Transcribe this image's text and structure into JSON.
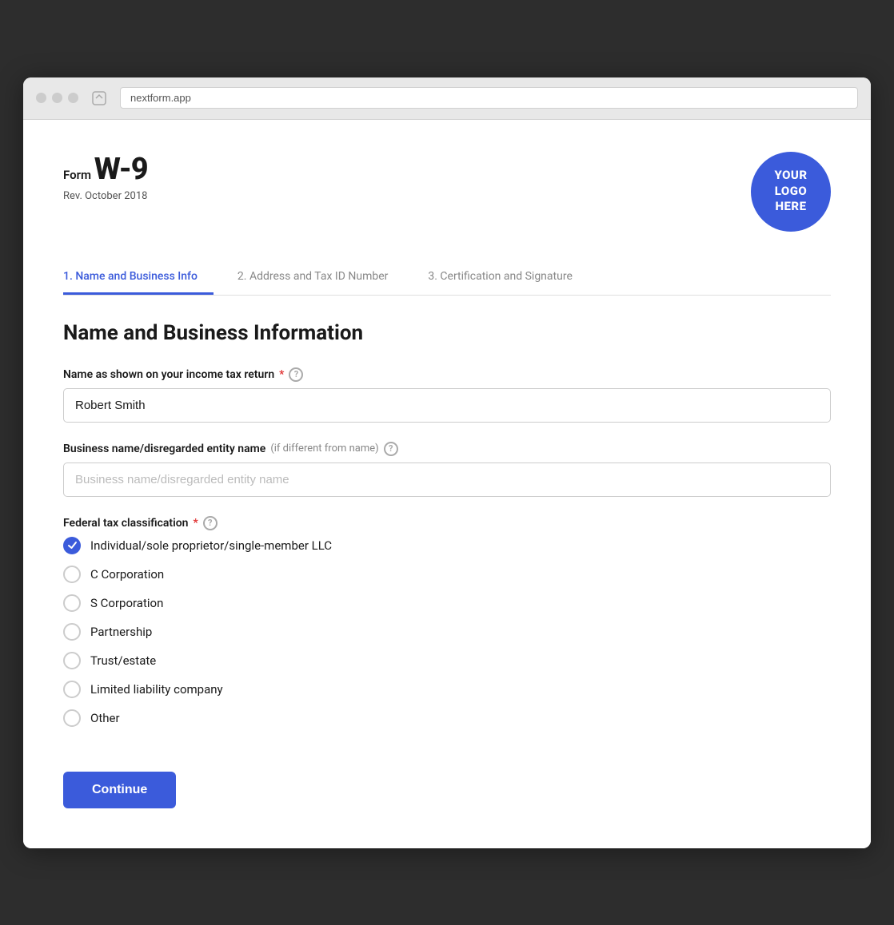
{
  "browser": {
    "address": "nextform.app",
    "nav_icon": "◇"
  },
  "logo": {
    "line1": "YOUR",
    "line2": "LOGO",
    "line3": "HERE"
  },
  "form": {
    "prefix": "Form",
    "title": "W-9",
    "subtitle": "Rev. October 2018"
  },
  "tabs": [
    {
      "id": "tab1",
      "label": "1. Name and Business Info",
      "active": true
    },
    {
      "id": "tab2",
      "label": "2. Address and Tax ID Number",
      "active": false
    },
    {
      "id": "tab3",
      "label": "3. Certification and Signature",
      "active": false
    }
  ],
  "section": {
    "title": "Name and Business Information"
  },
  "fields": {
    "name_label": "Name as shown on your income tax return",
    "name_value": "Robert Smith",
    "name_placeholder": "",
    "business_label": "Business name/disregarded entity name",
    "business_optional": "(if different from name)",
    "business_placeholder": "Business name/disregarded entity name",
    "tax_label": "Federal tax classification"
  },
  "tax_classifications": [
    {
      "id": "indiv",
      "label": "Individual/sole proprietor/single-member LLC",
      "checked": true
    },
    {
      "id": "ccorp",
      "label": "C Corporation",
      "checked": false
    },
    {
      "id": "scorp",
      "label": "S Corporation",
      "checked": false
    },
    {
      "id": "partner",
      "label": "Partnership",
      "checked": false
    },
    {
      "id": "trust",
      "label": "Trust/estate",
      "checked": false
    },
    {
      "id": "llc",
      "label": "Limited liability company",
      "checked": false
    },
    {
      "id": "other",
      "label": "Other",
      "checked": false
    }
  ],
  "buttons": {
    "continue": "Continue"
  }
}
